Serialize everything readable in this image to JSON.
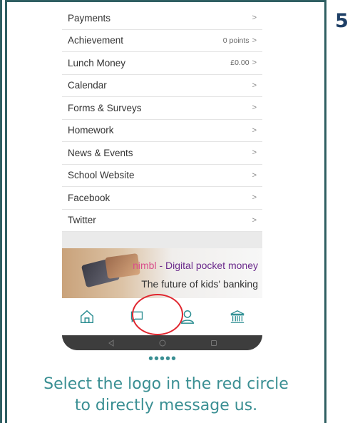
{
  "step": {
    "number": "5"
  },
  "menu": {
    "items": [
      {
        "label": "Payments",
        "value": "",
        "chevron": ">"
      },
      {
        "label": "Achievement",
        "value": "0 points",
        "chevron": ">"
      },
      {
        "label": "Lunch Money",
        "value": "£0.00",
        "chevron": ">"
      },
      {
        "label": "Calendar",
        "value": "",
        "chevron": ">"
      },
      {
        "label": "Forms & Surveys",
        "value": "",
        "chevron": ">"
      },
      {
        "label": "Homework",
        "value": "",
        "chevron": ">"
      },
      {
        "label": "News & Events",
        "value": "",
        "chevron": ">"
      },
      {
        "label": "School Website",
        "value": "",
        "chevron": ">"
      },
      {
        "label": "Facebook",
        "value": "",
        "chevron": ">"
      },
      {
        "label": "Twitter",
        "value": "",
        "chevron": ">"
      }
    ]
  },
  "banner": {
    "brand": "nimbl",
    "line1_rest": " - Digital pocket money",
    "line2": "The future of kids' banking"
  },
  "tabbar": {
    "tabs": [
      "home-icon",
      "message-icon",
      "profile-icon",
      "school-icon"
    ]
  },
  "caption": {
    "dots": "•••••",
    "instruction_line1": "Select the logo in the red circle",
    "instruction_line2": "to directly message us."
  },
  "colors": {
    "frame": "#2f5f62",
    "step_number": "#1e3f66",
    "caption": "#3a8f93",
    "highlight_circle": "#e0262f",
    "tab_icon": "#2a8d91"
  }
}
